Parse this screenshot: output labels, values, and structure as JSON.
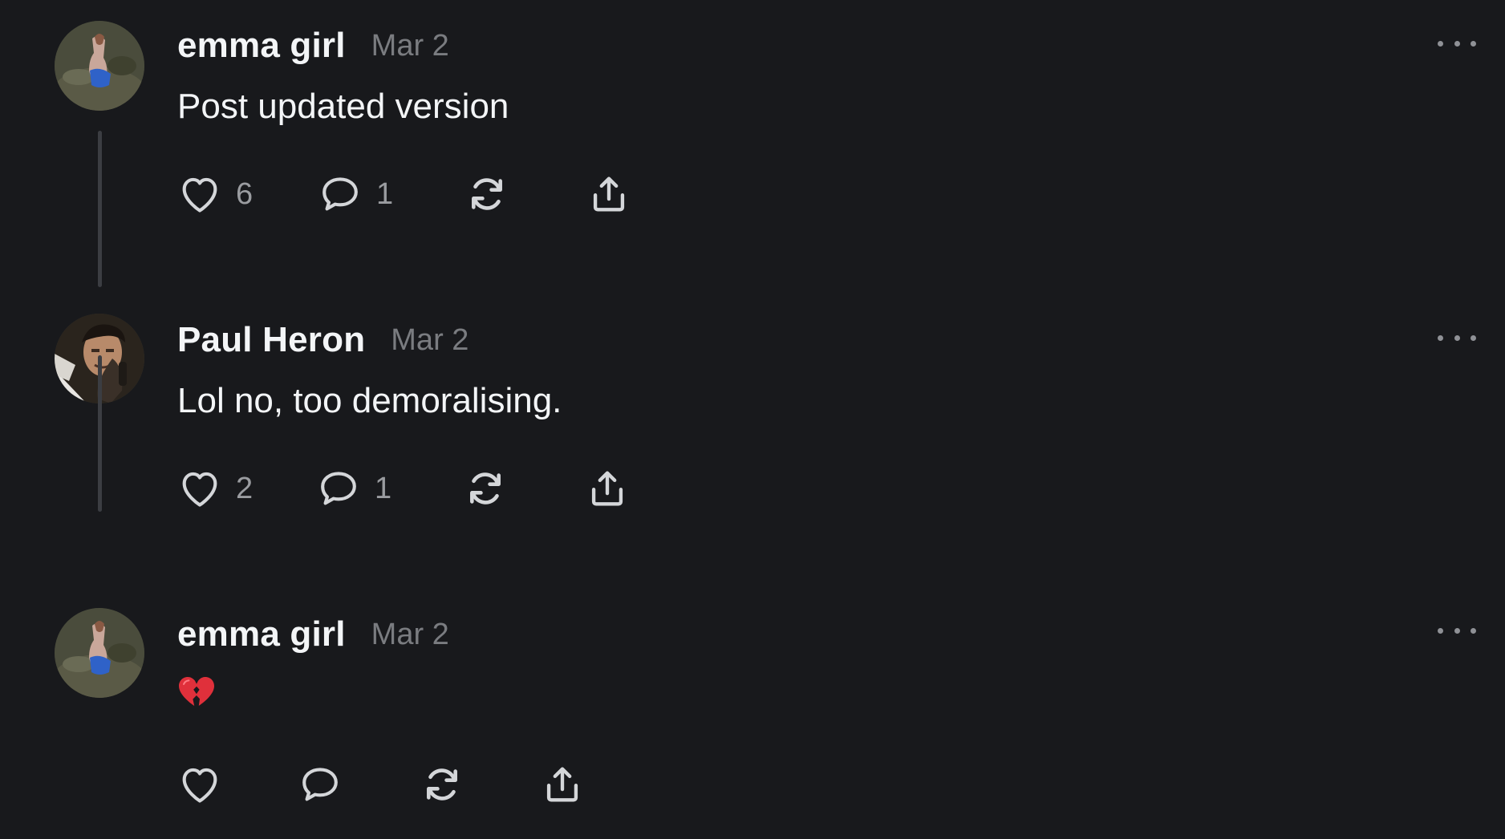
{
  "posts": [
    {
      "username": "emma girl",
      "date": "Mar 2",
      "text": "Post updated version",
      "likes": "6",
      "replies": "1",
      "avatar": "emma-avatar"
    },
    {
      "username": "Paul Heron",
      "date": "Mar 2",
      "text": "Lol no, too demoralising.",
      "likes": "2",
      "replies": "1",
      "avatar": "paul-avatar"
    },
    {
      "username": "emma girl",
      "date": "Mar 2",
      "emoji": "broken-heart-icon",
      "avatar": "emma-avatar"
    }
  ],
  "colors": {
    "background": "#18191c",
    "primary_text": "#f3f5f7",
    "secondary_text": "#7a7c80",
    "icon": "#d4d6d9",
    "thread_line": "#3b3d42",
    "broken_heart": "#e0303b"
  }
}
